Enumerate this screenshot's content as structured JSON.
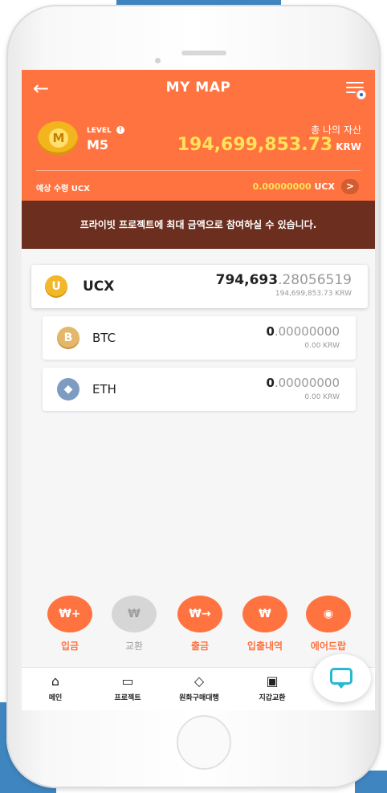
{
  "header": {
    "back_icon": "arrow-left-icon",
    "title": "MY MAP",
    "menu_icon": "menu-language-icon",
    "level_label": "LEVEL",
    "level_value": "M5",
    "level_coin_letter": "M",
    "total_assets_label": "총 나의 자산",
    "total_assets_value": "194,699,853.73",
    "total_assets_unit": "KRW",
    "expected_label": "예상 수령 UCX",
    "expected_value": "0.00000000",
    "expected_unit": "UCX",
    "expected_arrow": ">"
  },
  "notice": "프라이빗 프로젝트에 최대 금액으로 참여하실 수 있습니다.",
  "assets": [
    {
      "symbol": "UCX",
      "icon_letter": "U",
      "amount_int": "794,693",
      "amount_frac": ".28056519",
      "krw": "194,699,853.73 KRW"
    },
    {
      "symbol": "BTC",
      "icon_letter": "B",
      "amount_int": "0",
      "amount_frac": ".00000000",
      "krw": "0.00 KRW"
    },
    {
      "symbol": "ETH",
      "icon_letter": "◆",
      "amount_int": "0",
      "amount_frac": ".00000000",
      "krw": "0.00 KRW"
    }
  ],
  "actions": [
    {
      "label": "입금",
      "icon": "deposit-won-icon",
      "glyph": "₩+",
      "enabled": true
    },
    {
      "label": "교환",
      "icon": "exchange-won-icon",
      "glyph": "₩",
      "enabled": false
    },
    {
      "label": "출금",
      "icon": "withdraw-won-icon",
      "glyph": "₩→",
      "enabled": true
    },
    {
      "label": "입출내역",
      "icon": "history-won-icon",
      "glyph": "₩",
      "enabled": true
    },
    {
      "label": "에어드랍",
      "icon": "airdrop-icon",
      "glyph": "◉",
      "enabled": true
    }
  ],
  "nav": [
    {
      "label": "메인",
      "icon": "home-icon",
      "glyph": "⌂"
    },
    {
      "label": "프로젝트",
      "icon": "folder-icon",
      "glyph": "▭"
    },
    {
      "label": "원화구매대행",
      "icon": "tag-icon",
      "glyph": "◇"
    },
    {
      "label": "지갑교환",
      "icon": "wallet-icon",
      "glyph": "▣"
    }
  ],
  "colors": {
    "brand_orange": "#ff7340",
    "notice_brown": "#6c2e1e",
    "highlight_yellow": "#ffe15a",
    "chat_teal": "#2ab8d0"
  }
}
